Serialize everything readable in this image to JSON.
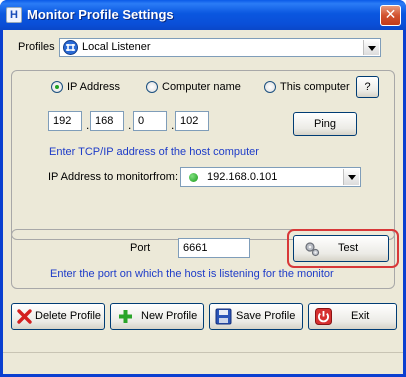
{
  "window": {
    "title": "Monitor Profile Settings",
    "app_icon_glyph": "H",
    "close_glyph": "✕"
  },
  "profiles": {
    "label": "Profiles",
    "selected": "Local Listener",
    "icon": "profile-globe-icon"
  },
  "address": {
    "options": [
      {
        "label": "IP Address",
        "checked": true
      },
      {
        "label": "Computer name",
        "checked": false
      },
      {
        "label": "This computer",
        "checked": false
      }
    ],
    "help_label": "?",
    "octets": [
      "192",
      "168",
      "0",
      "102"
    ],
    "separator": ".",
    "ping_label": "Ping",
    "hint": "Enter TCP/IP address of the host computer",
    "monitor_from_label": "IP Address to monitorfrom:",
    "monitor_from_value": "192.168.0.101"
  },
  "port": {
    "label": "Port",
    "value": "6661",
    "test_label": "Test",
    "hint": "Enter the port on which the host is listening for the monitor"
  },
  "buttons": {
    "delete": "Delete Profile",
    "new": "New Profile",
    "save": "Save Profile",
    "exit": "Exit"
  },
  "colors": {
    "hint_text": "#1e3cc8",
    "highlight": "#d83838",
    "status_dot": "#1a9a1a"
  }
}
